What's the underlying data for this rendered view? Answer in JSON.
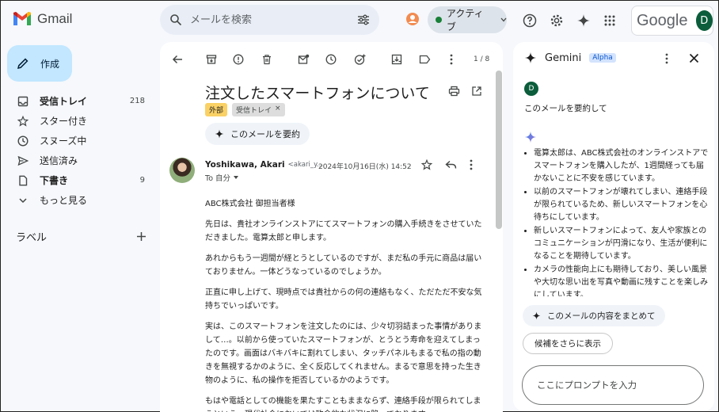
{
  "app": {
    "name": "Gmail"
  },
  "search": {
    "placeholder": "メールを検索"
  },
  "status": {
    "label": "アクティブ"
  },
  "account": {
    "brand": "Google",
    "initial": "D"
  },
  "compose": {
    "label": "作成"
  },
  "nav": {
    "items": [
      {
        "label": "受信トレイ",
        "count": "218",
        "icon": "inbox-icon",
        "bold": true
      },
      {
        "label": "スター付き",
        "count": "",
        "icon": "star-icon",
        "bold": false
      },
      {
        "label": "スヌーズ中",
        "count": "",
        "icon": "clock-icon",
        "bold": false
      },
      {
        "label": "送信済み",
        "count": "",
        "icon": "send-icon",
        "bold": false
      },
      {
        "label": "下書き",
        "count": "9",
        "icon": "draft-icon",
        "bold": true
      },
      {
        "label": "もっと見る",
        "count": "",
        "icon": "chevron-down-icon",
        "bold": false
      }
    ],
    "labels_heading": "ラベル"
  },
  "toolbar": {
    "pager": "1 / 8"
  },
  "message": {
    "subject": "注文したスマートフォンについて",
    "tag_external": "外部",
    "tag_inbox": "受信トレイ",
    "summarize_label": "このメールを要約",
    "sender_name": "Yoshikawa, Akari",
    "sender_email": "<akari_y...",
    "date": "2024年10月16日(水) 14:52",
    "to": "To 自分",
    "paragraphs": [
      "ABC株式会社 御担当者様",
      "先日は、貴社オンラインストアにてスマートフォンの購入手続きをさせていただきました。電算太郎と申します。",
      "あれからもう一週間が経とうとしているのですが、まだ私の手元に商品は届いておりません。一体どうなっているのでしょうか。",
      "正直に申し上げて、現時点では貴社からの何の連絡もなく、ただただ不安な気持ちでいっぱいです。",
      "実は、このスマートフォンを注文したのには、少々切羽詰まった事情がありまして…。以前から使っていたスマートフォンが、とうとう寿命を迎えてしまったのです。画面はバキバキに割れてしまい、タッチパネルもまるで私の指の動きを無視するかのように、全く反応してくれません。まるで意思を持った生き物のように、私の操作を拒否しているかのようです。",
      "もはや電話としての機能を果たすこともままならず、連絡手段が限られてしまうという、現代社会においては致命的な状況に陥っております。"
    ]
  },
  "gemini": {
    "title": "Gemini",
    "badge": "Alpha",
    "user_initial": "D",
    "user_prompt": "このメールを要約して",
    "bullets": [
      "電算太郎は、ABC株式会社のオンラインストアでスマートフォンを購入したが、1週間経っても届かないことに不安を感じています。",
      "以前のスマートフォンが壊れてしまい、連絡手段が限られているため、新しいスマートフォンを心待ちにしています。",
      "新しいスマートフォンによって、友人や家族とのコミュニケーションが円滑になり、生活が便利になることを期待しています。",
      "カメラの性能向上にも期待しており、美しい風景や大切な思い出を写真や動画に残すことを楽しみにしています。"
    ],
    "suggestion_1": "このメールの内容をまとめて",
    "suggestion_2": "候補をさらに表示",
    "input_placeholder": "ここにプロンプトを入力"
  },
  "colors": {
    "compose_bg": "#c2e7ff",
    "status_green": "#188038",
    "tag_external": "#fad165",
    "gemini_blue": "#1a73e8",
    "avatar_green": "#0b5d3b"
  }
}
